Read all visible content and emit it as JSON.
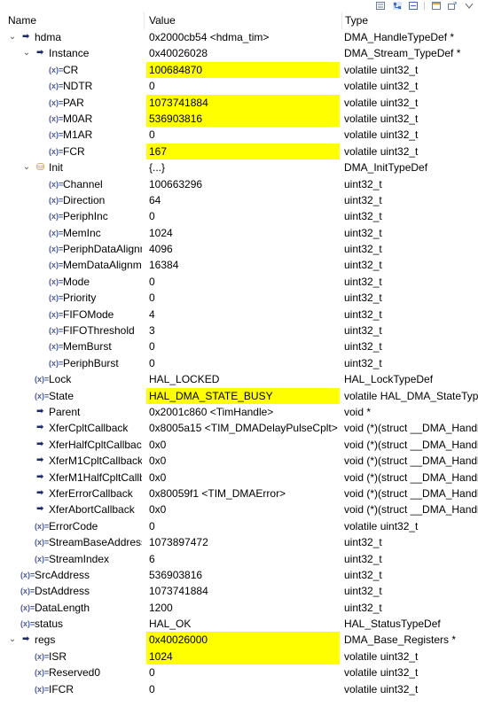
{
  "toolbar": {
    "icons": [
      "show-type-names-icon",
      "show-logical-structure-icon",
      "collapse-all-icon",
      "layout-icon",
      "new-expression-icon",
      "view-menu-icon"
    ]
  },
  "header": {
    "name": "Name",
    "value": "Value",
    "type": "Type"
  },
  "rows": [
    {
      "indent": 0,
      "twisty": "open",
      "icon": "pointer",
      "name": "hdma",
      "value": "0x2000cb54 <hdma_tim>",
      "type": "DMA_HandleTypeDef *",
      "changed": false
    },
    {
      "indent": 1,
      "twisty": "open",
      "icon": "pointer",
      "name": "Instance",
      "value": "0x40026028",
      "type": "DMA_Stream_TypeDef *",
      "changed": false
    },
    {
      "indent": 2,
      "twisty": "none",
      "icon": "field",
      "name": "CR",
      "value": "100684870",
      "type": "volatile uint32_t",
      "changed": true
    },
    {
      "indent": 2,
      "twisty": "none",
      "icon": "field",
      "name": "NDTR",
      "value": "0",
      "type": "volatile uint32_t",
      "changed": false
    },
    {
      "indent": 2,
      "twisty": "none",
      "icon": "field",
      "name": "PAR",
      "value": "1073741884",
      "type": "volatile uint32_t",
      "changed": true
    },
    {
      "indent": 2,
      "twisty": "none",
      "icon": "field",
      "name": "M0AR",
      "value": "536903816",
      "type": "volatile uint32_t",
      "changed": true
    },
    {
      "indent": 2,
      "twisty": "none",
      "icon": "field",
      "name": "M1AR",
      "value": "0",
      "type": "volatile uint32_t",
      "changed": false
    },
    {
      "indent": 2,
      "twisty": "none",
      "icon": "field",
      "name": "FCR",
      "value": "167",
      "type": "volatile uint32_t",
      "changed": true
    },
    {
      "indent": 1,
      "twisty": "open",
      "icon": "struct",
      "name": "Init",
      "value": "{...}",
      "type": "DMA_InitTypeDef",
      "changed": false
    },
    {
      "indent": 2,
      "twisty": "none",
      "icon": "field",
      "name": "Channel",
      "value": "100663296",
      "type": "uint32_t",
      "changed": false
    },
    {
      "indent": 2,
      "twisty": "none",
      "icon": "field",
      "name": "Direction",
      "value": "64",
      "type": "uint32_t",
      "changed": false
    },
    {
      "indent": 2,
      "twisty": "none",
      "icon": "field",
      "name": "PeriphInc",
      "value": "0",
      "type": "uint32_t",
      "changed": false
    },
    {
      "indent": 2,
      "twisty": "none",
      "icon": "field",
      "name": "MemInc",
      "value": "1024",
      "type": "uint32_t",
      "changed": false
    },
    {
      "indent": 2,
      "twisty": "none",
      "icon": "field",
      "name": "PeriphDataAlignm",
      "value": "4096",
      "type": "uint32_t",
      "changed": false
    },
    {
      "indent": 2,
      "twisty": "none",
      "icon": "field",
      "name": "MemDataAlignm",
      "value": "16384",
      "type": "uint32_t",
      "changed": false
    },
    {
      "indent": 2,
      "twisty": "none",
      "icon": "field",
      "name": "Mode",
      "value": "0",
      "type": "uint32_t",
      "changed": false
    },
    {
      "indent": 2,
      "twisty": "none",
      "icon": "field",
      "name": "Priority",
      "value": "0",
      "type": "uint32_t",
      "changed": false
    },
    {
      "indent": 2,
      "twisty": "none",
      "icon": "field",
      "name": "FIFOMode",
      "value": "4",
      "type": "uint32_t",
      "changed": false
    },
    {
      "indent": 2,
      "twisty": "none",
      "icon": "field",
      "name": "FIFOThreshold",
      "value": "3",
      "type": "uint32_t",
      "changed": false
    },
    {
      "indent": 2,
      "twisty": "none",
      "icon": "field",
      "name": "MemBurst",
      "value": "0",
      "type": "uint32_t",
      "changed": false
    },
    {
      "indent": 2,
      "twisty": "none",
      "icon": "field",
      "name": "PeriphBurst",
      "value": "0",
      "type": "uint32_t",
      "changed": false
    },
    {
      "indent": 1,
      "twisty": "none",
      "icon": "field",
      "name": "Lock",
      "value": "HAL_LOCKED",
      "type": "HAL_LockTypeDef",
      "changed": false
    },
    {
      "indent": 1,
      "twisty": "none",
      "icon": "field",
      "name": "State",
      "value": "HAL_DMA_STATE_BUSY",
      "type": "volatile HAL_DMA_StateType",
      "changed": true
    },
    {
      "indent": 1,
      "twisty": "none",
      "icon": "pointer",
      "name": "Parent",
      "value": "0x2001c860 <TimHandle>",
      "type": "void *",
      "changed": false
    },
    {
      "indent": 1,
      "twisty": "none",
      "icon": "pointer",
      "name": "XferCpltCallback",
      "value": "0x8005a15 <TIM_DMADelayPulseCplt>",
      "type": "void (*)(struct __DMA_Handle",
      "changed": false
    },
    {
      "indent": 1,
      "twisty": "none",
      "icon": "pointer",
      "name": "XferHalfCpltCallbacl",
      "value": "0x0",
      "type": "void (*)(struct __DMA_Handle",
      "changed": false
    },
    {
      "indent": 1,
      "twisty": "none",
      "icon": "pointer",
      "name": "XferM1CpltCallback",
      "value": "0x0",
      "type": "void (*)(struct __DMA_Handle",
      "changed": false
    },
    {
      "indent": 1,
      "twisty": "none",
      "icon": "pointer",
      "name": "XferM1HalfCpltCallb",
      "value": "0x0",
      "type": "void (*)(struct __DMA_Handle",
      "changed": false
    },
    {
      "indent": 1,
      "twisty": "none",
      "icon": "pointer",
      "name": "XferErrorCallback",
      "value": "0x80059f1 <TIM_DMAError>",
      "type": "void (*)(struct __DMA_Handle",
      "changed": false
    },
    {
      "indent": 1,
      "twisty": "none",
      "icon": "pointer",
      "name": "XferAbortCallback",
      "value": "0x0",
      "type": "void (*)(struct __DMA_Handle",
      "changed": false
    },
    {
      "indent": 1,
      "twisty": "none",
      "icon": "field",
      "name": "ErrorCode",
      "value": "0",
      "type": "volatile uint32_t",
      "changed": false
    },
    {
      "indent": 1,
      "twisty": "none",
      "icon": "field",
      "name": "StreamBaseAddress",
      "value": "1073897472",
      "type": "uint32_t",
      "changed": false
    },
    {
      "indent": 1,
      "twisty": "none",
      "icon": "field",
      "name": "StreamIndex",
      "value": "6",
      "type": "uint32_t",
      "changed": false
    },
    {
      "indent": 0,
      "twisty": "none",
      "icon": "field",
      "name": "SrcAddress",
      "value": "536903816",
      "type": "uint32_t",
      "changed": false
    },
    {
      "indent": 0,
      "twisty": "none",
      "icon": "field",
      "name": "DstAddress",
      "value": "1073741884",
      "type": "uint32_t",
      "changed": false
    },
    {
      "indent": 0,
      "twisty": "none",
      "icon": "field",
      "name": "DataLength",
      "value": "1200",
      "type": "uint32_t",
      "changed": false
    },
    {
      "indent": 0,
      "twisty": "none",
      "icon": "field",
      "name": "status",
      "value": "HAL_OK",
      "type": "HAL_StatusTypeDef",
      "changed": false
    },
    {
      "indent": 0,
      "twisty": "open",
      "icon": "pointer",
      "name": "regs",
      "value": "0x40026000",
      "type": "DMA_Base_Registers *",
      "changed": true
    },
    {
      "indent": 1,
      "twisty": "none",
      "icon": "field",
      "name": "ISR",
      "value": "1024",
      "type": "volatile uint32_t",
      "changed": true
    },
    {
      "indent": 1,
      "twisty": "none",
      "icon": "field",
      "name": "Reserved0",
      "value": "0",
      "type": "volatile uint32_t",
      "changed": false
    },
    {
      "indent": 1,
      "twisty": "none",
      "icon": "field",
      "name": "IFCR",
      "value": "0",
      "type": "volatile uint32_t",
      "changed": false
    }
  ],
  "glyphs": {
    "twisty_open": "⌄",
    "field": "(x)=",
    "pointer": "➡",
    "struct": "⛁"
  },
  "colors": {
    "changed_highlight": "#ffff00",
    "header_separator": "#e6e6e6"
  }
}
